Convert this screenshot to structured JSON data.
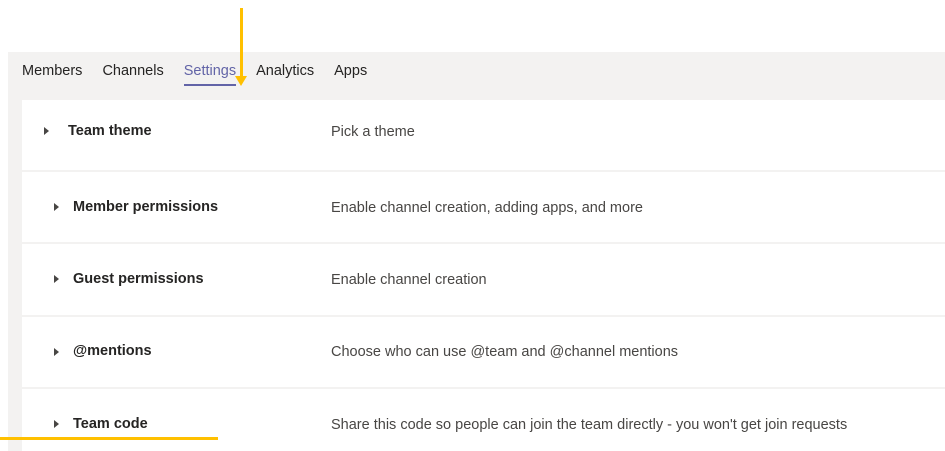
{
  "tabs": {
    "members": "Members",
    "channels": "Channels",
    "settings": "Settings",
    "analytics": "Analytics",
    "apps": "Apps",
    "active": "Settings"
  },
  "settings_rows": [
    {
      "title": "Team theme",
      "description": "Pick a theme"
    },
    {
      "title": "Member permissions",
      "description": "Enable channel creation, adding apps, and more"
    },
    {
      "title": "Guest permissions",
      "description": "Enable channel creation"
    },
    {
      "title": "@mentions",
      "description": "Choose who can use @team and @channel mentions"
    },
    {
      "title": "Team code",
      "description": "Share this code so people can join the team directly - you won't get join requests"
    }
  ],
  "colors": {
    "accent": "#6264a7",
    "annotation": "#ffc000",
    "background": "#f3f2f1",
    "row": "#ffffff",
    "text": "#252423"
  },
  "icons": {
    "row_expand": "chevron-right-icon",
    "annotation": "arrow-down-icon"
  }
}
